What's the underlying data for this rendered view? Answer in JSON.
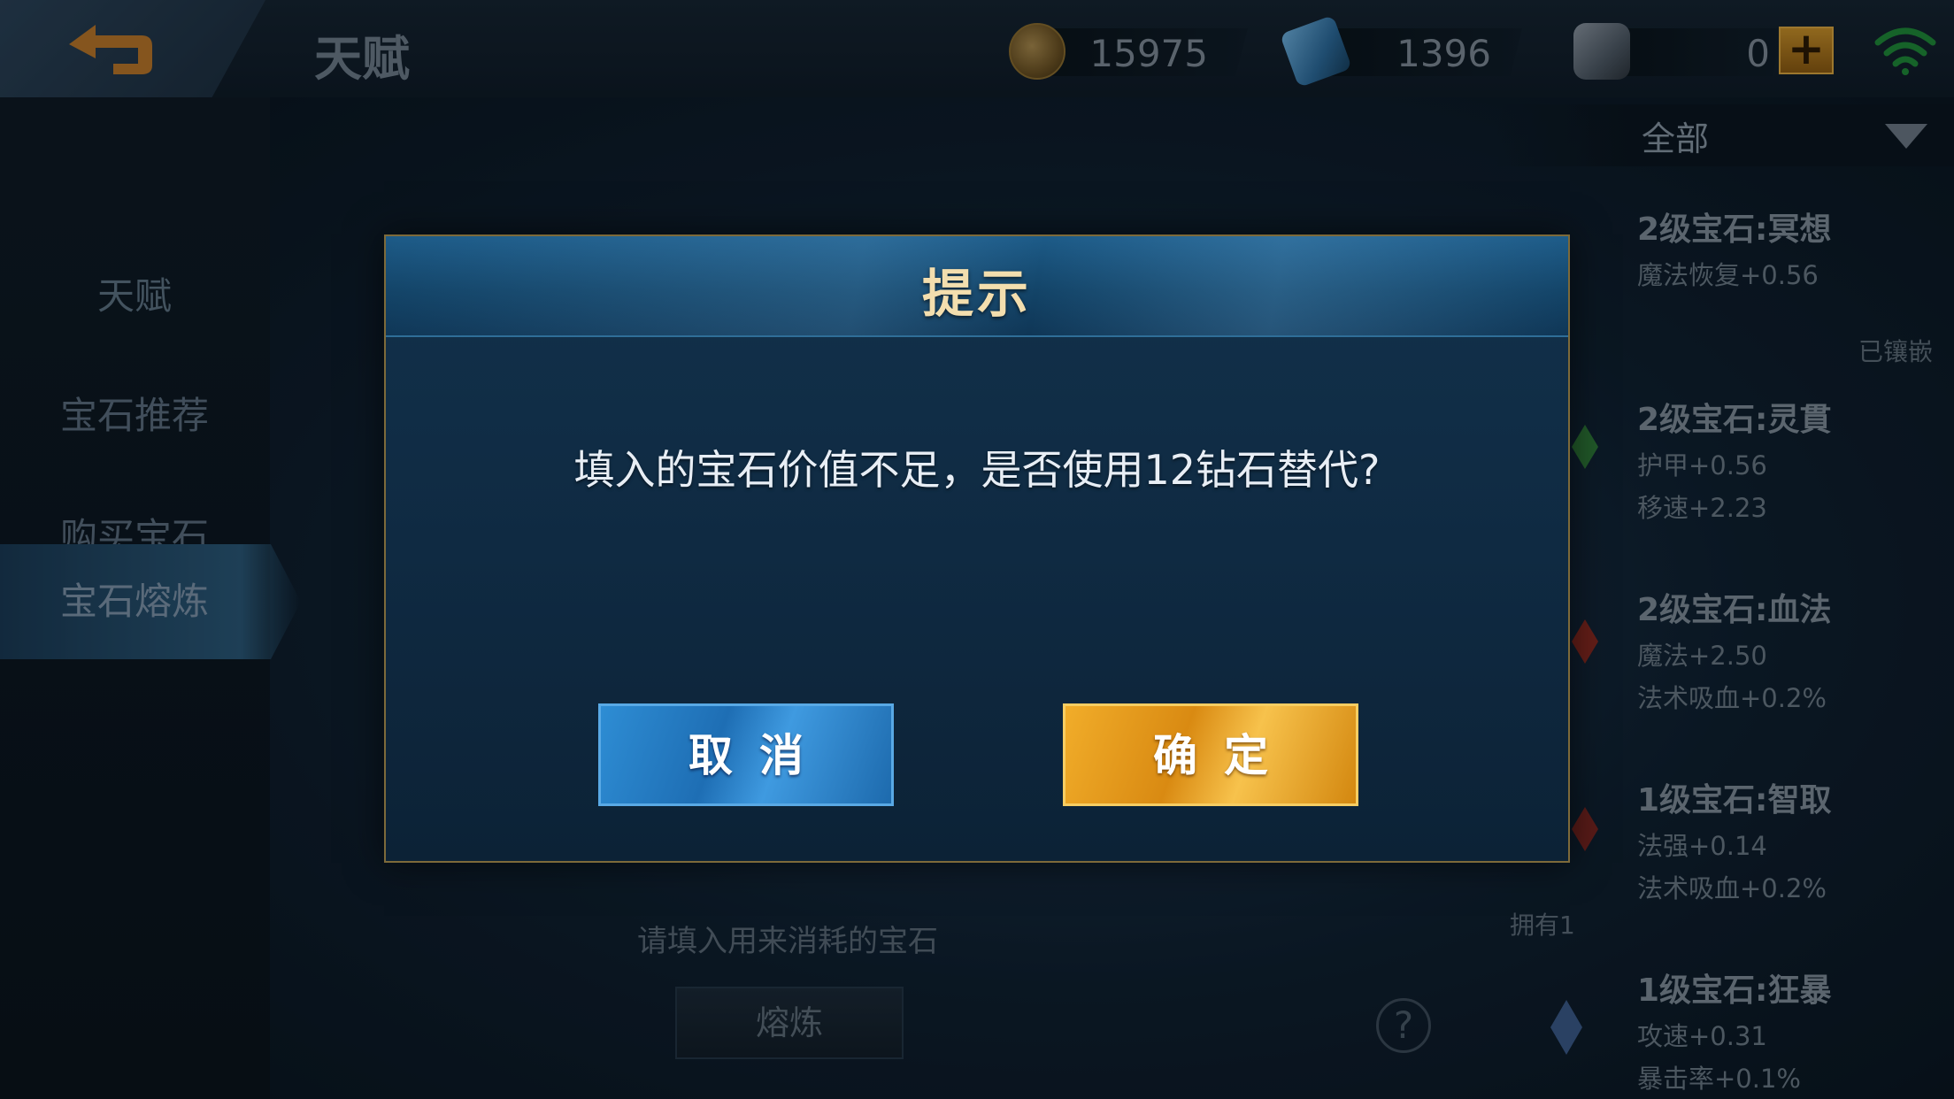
{
  "header": {
    "back_icon": "back-arrow-icon",
    "title": "天赋",
    "currencies": [
      {
        "icon": "gold-coin-icon",
        "value": "15975"
      },
      {
        "icon": "diamond-icon",
        "value": "1396"
      },
      {
        "icon": "crystal-icon",
        "value": "0"
      }
    ],
    "add_label": "+",
    "wifi_icon": "wifi-icon"
  },
  "sidebar": {
    "items": [
      {
        "label": "天赋"
      },
      {
        "label": "宝石推荐"
      },
      {
        "label": "购买宝石"
      },
      {
        "label": "宝石熔炼",
        "active": true
      }
    ]
  },
  "filter": {
    "selected": "全部"
  },
  "gems": [
    {
      "name": "2级宝石:冥想",
      "stats": [
        "魔法恢复+0.56"
      ]
    },
    {
      "name": "2级宝石:灵貫",
      "stats": [
        "护甲+0.56",
        "移速+2.23"
      ]
    },
    {
      "name": "2级宝石:血法",
      "stats": [
        "魔法+2.50",
        "法术吸血+0.2%"
      ]
    },
    {
      "name": "1级宝石:智取",
      "stats": [
        "法强+0.14",
        "法术吸血+0.2%"
      ]
    },
    {
      "name": "1级宝石:狂暴",
      "stats": [
        "攻速+0.31",
        "暴击率+0.1%"
      ]
    }
  ],
  "equipped_tag": "已镶嵌",
  "smelt": {
    "hint": "请填入用来消耗的宝石",
    "button_label": "熔炼",
    "own_count": "拥有1",
    "help_label": "?"
  },
  "dialog": {
    "title": "提示",
    "message": "填入的宝石价值不足，是否使用12钻石替代?",
    "cancel_label": "取消",
    "confirm_label": "确定"
  },
  "colors": {
    "dialog_title": "#f3deae",
    "cancel_button": "#1e6eb4",
    "confirm_button": "#d98a12",
    "dialog_border": "#7d6a3a"
  }
}
